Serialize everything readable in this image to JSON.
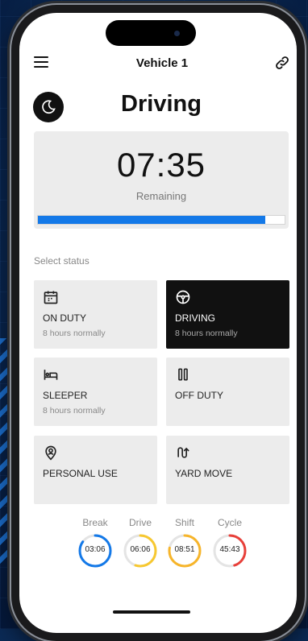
{
  "header": {
    "vehicle_title": "Vehicle 1"
  },
  "main": {
    "status_title": "Driving",
    "timer": {
      "value": "07:35",
      "subtitle": "Remaining",
      "progress_fraction": 0.92
    }
  },
  "select_status": {
    "label": "Select status",
    "options": [
      {
        "name": "ON DUTY",
        "hint": "8 hours normally",
        "icon": "calendar-icon",
        "active": false
      },
      {
        "name": "DRIVING",
        "hint": "8 hours normally",
        "icon": "steering-wheel-icon",
        "active": true
      },
      {
        "name": "SLEEPER",
        "hint": "8 hours normally",
        "icon": "bed-icon",
        "active": false
      },
      {
        "name": "OFF DUTY",
        "hint": "",
        "icon": "pause-icon",
        "active": false
      },
      {
        "name": "PERSONAL USE",
        "hint": "",
        "icon": "location-person-icon",
        "active": false
      },
      {
        "name": "YARD MOVE",
        "hint": "",
        "icon": "route-icon",
        "active": false
      }
    ]
  },
  "gauges": [
    {
      "label": "Break",
      "value": "03:06",
      "color": "#1479e8",
      "fraction": 0.85
    },
    {
      "label": "Drive",
      "value": "06:06",
      "color": "#f7c830",
      "fraction": 0.55
    },
    {
      "label": "Shift",
      "value": "08:51",
      "color": "#f7b52a",
      "fraction": 0.78
    },
    {
      "label": "Cycle",
      "value": "45:43",
      "color": "#e8403a",
      "fraction": 0.45
    }
  ],
  "colors": {
    "accent": "#1479e8",
    "active_card": "#111111"
  }
}
